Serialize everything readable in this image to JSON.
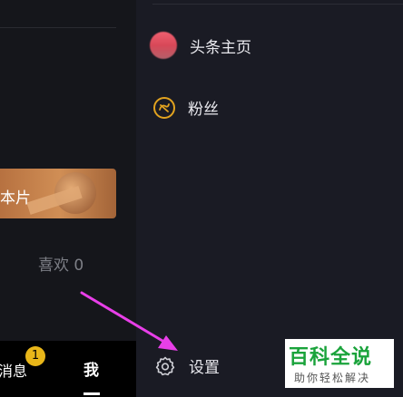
{
  "left_panel": {
    "banner_text": "本片",
    "likes_label": "喜欢 0",
    "tabs": {
      "messages_label": "消息",
      "messages_badge": "1",
      "me_label": "我"
    }
  },
  "menu": {
    "items": [
      {
        "label": "头条主页",
        "icon": "avatar"
      },
      {
        "label": "粉丝",
        "icon": "fans-icon"
      },
      {
        "label": "设置",
        "icon": "gear-icon"
      }
    ]
  },
  "watermark": {
    "title": "百科全说",
    "subtitle": "助你轻松解决"
  },
  "colors": {
    "accent": "#e2a31f",
    "arrow": "#e83fe8",
    "watermark_green": "#1aa33b"
  }
}
